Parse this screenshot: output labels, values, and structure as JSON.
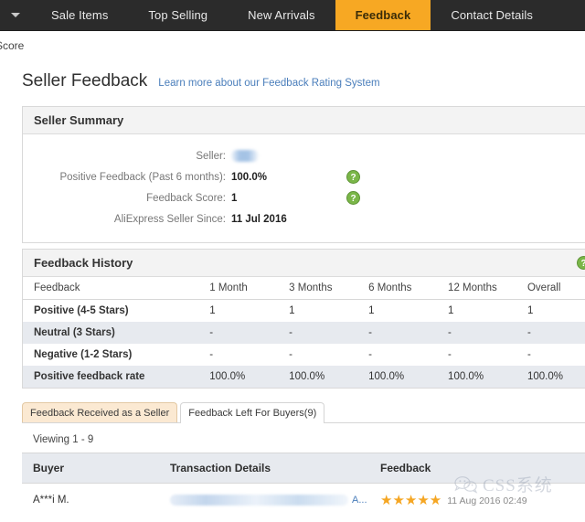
{
  "nav": {
    "caret_icon": "chevron-down-icon",
    "items": [
      {
        "label": "Sale Items",
        "active": false
      },
      {
        "label": "Top Selling",
        "active": false
      },
      {
        "label": "New Arrivals",
        "active": false
      },
      {
        "label": "Feedback",
        "active": true
      },
      {
        "label": "Contact Details",
        "active": false
      }
    ],
    "active_color": "#f7a823",
    "bar_color": "#2b2b2b"
  },
  "scrolled_text": "Score",
  "page": {
    "title": "Seller Feedback",
    "link": "Learn more about our Feedback Rating System",
    "link_color": "#4a7ebb"
  },
  "seller_summary": {
    "heading": "Seller Summary",
    "rows": [
      {
        "label": "Seller:",
        "value": "",
        "blurred": true,
        "help": false
      },
      {
        "label": "Positive Feedback (Past 6 months):",
        "value": "100.0%",
        "blurred": false,
        "help": true
      },
      {
        "label": "Feedback Score:",
        "value": "1",
        "blurred": false,
        "help": true
      },
      {
        "label": "AliExpress Seller Since:",
        "value": "11 Jul 2016",
        "blurred": false,
        "help": false
      }
    ],
    "help_icon": "question-mark-icon",
    "help_color": "#7ab648"
  },
  "feedback_history": {
    "heading": "Feedback History",
    "help_icon": "question-mark-icon",
    "columns": [
      "Feedback",
      "1 Month",
      "3 Months",
      "6 Months",
      "12 Months",
      "Overall"
    ],
    "rows": [
      {
        "label": "Positive (4-5 Stars)",
        "values": [
          "1",
          "1",
          "1",
          "1",
          "1"
        ],
        "link": true,
        "alt": false
      },
      {
        "label": "Neutral (3 Stars)",
        "values": [
          "-",
          "-",
          "-",
          "-",
          "-"
        ],
        "link": false,
        "alt": true
      },
      {
        "label": "Negative (1-2 Stars)",
        "values": [
          "-",
          "-",
          "-",
          "-",
          "-"
        ],
        "link": false,
        "alt": false
      },
      {
        "label": "Positive feedback rate",
        "values": [
          "100.0%",
          "100.0%",
          "100.0%",
          "100.0%",
          "100.0%"
        ],
        "link": false,
        "alt": true
      }
    ]
  },
  "tabs": [
    {
      "label": "Feedback Received as a Seller",
      "active": false
    },
    {
      "label": "Feedback Left For Buyers(9)",
      "active": true
    }
  ],
  "buyer_table": {
    "viewing": "Viewing 1 - 9",
    "columns": [
      "Buyer",
      "Transaction Details",
      "Feedback"
    ],
    "rows": [
      {
        "buyer": "A***i M.",
        "transaction_blurred": true,
        "transaction_more": "A...",
        "stars": "★★★★★",
        "star_count": 5,
        "date": "11 Aug 2016 02:49",
        "comment": ""
      }
    ],
    "star_color": "#f5a623"
  },
  "watermark": {
    "text": "CSS系统",
    "logo_icon": "wechat-icon"
  }
}
